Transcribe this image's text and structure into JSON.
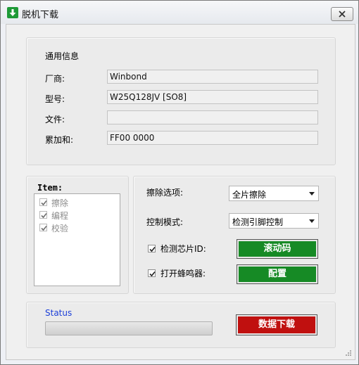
{
  "window": {
    "title": "脱机下载"
  },
  "info": {
    "group_title": "通用信息",
    "vendor_label": "厂商:",
    "vendor_value": "Winbond",
    "model_label": "型号:",
    "model_value": "W25Q128JV [SO8]",
    "file_label": "文件:",
    "file_value": "",
    "checksum_label": "累加和:",
    "checksum_value": "FF00 0000"
  },
  "items": {
    "title": "Item:",
    "list": [
      {
        "label": "擦除",
        "checked": true
      },
      {
        "label": "编程",
        "checked": true
      },
      {
        "label": "校验",
        "checked": true
      }
    ]
  },
  "options": {
    "erase_label": "擦除选项:",
    "erase_value": "全片擦除",
    "control_label": "控制模式:",
    "control_value": "检测引脚控制",
    "detect_chip_label": "检测芯片ID:",
    "detect_chip_checked": true,
    "buzzer_label": "打开蜂鸣器:",
    "buzzer_checked": true,
    "rolling_code_button": "滚动码",
    "config_button": "配置"
  },
  "status": {
    "label": "Status",
    "progress": 0,
    "download_button": "数据下载"
  },
  "colors": {
    "green_button": "#168a25",
    "red_button": "#c0100f",
    "status_text": "#1c3fd8",
    "app_icon": "#1e9a37"
  }
}
